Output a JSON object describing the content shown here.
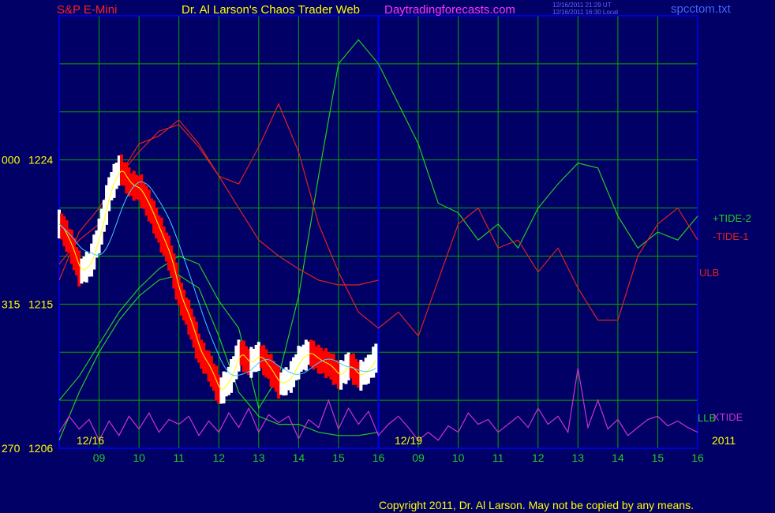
{
  "header": {
    "symbol": "S&P E-Mini",
    "title": "Dr. Al Larson's Chaos Trader Web",
    "site": "Daytradingforecasts.com",
    "time_ut": "12/16/2011 21:29 UT",
    "time_local": "12/16/2011 16:30 Local",
    "filename": "spcctom.txt"
  },
  "copyright": "Copyright 2011, Dr. Al Larson. May not be copied by any means.",
  "colors": {
    "background": "#000066",
    "grid": "#00aa00",
    "frame": "#0000ff",
    "tide_plus": "#22cc22",
    "tide_minus": "#cc1111",
    "xtide": "#cc33cc",
    "price_up": "#ffffff",
    "price_down": "#ff0000",
    "ma_fast": "#ffff00",
    "ma_slow": "#44ccff"
  },
  "chart_data": {
    "type": "line",
    "title": "S&P E-Mini",
    "y_labels": [
      {
        "left": "000",
        "price": "1224",
        "value": 1224
      },
      {
        "left": "315",
        "price": "1215",
        "value": 1215
      },
      {
        "left": "270",
        "price": "1206",
        "value": 1206
      }
    ],
    "ylim": [
      1206,
      1233
    ],
    "date_labels": [
      "12/16",
      "12/19"
    ],
    "year_label": "2011",
    "hour_ticks": [
      "09",
      "10",
      "11",
      "12",
      "13",
      "14",
      "15",
      "16",
      "09",
      "10",
      "11",
      "12",
      "13",
      "14",
      "15",
      "16"
    ],
    "series_labels": [
      {
        "name": "+TIDE-2",
        "color": "#22cc22"
      },
      {
        "name": "-TIDE-1",
        "color": "#dd2222"
      },
      {
        "name": "ULB",
        "color": "#dd2222"
      },
      {
        "name": "LLB",
        "color": "#22cc22"
      },
      {
        "name": "XTIDE",
        "color": "#cc33cc"
      }
    ],
    "series": [
      {
        "name": "+TIDE-2",
        "color": "#22cc22",
        "x": [
          0,
          0.5,
          1,
          1.5,
          2,
          2.5,
          3,
          3.5,
          4,
          4.5,
          5,
          5.5,
          6,
          6.5,
          7,
          7.5,
          8,
          8.5,
          9,
          9.5,
          10,
          10.5,
          11,
          11.5,
          12,
          12.5,
          13,
          13.5,
          14,
          14.5,
          15,
          15.5,
          16
        ],
        "y": [
          1209,
          1210.5,
          1212.5,
          1214.5,
          1216,
          1217.2,
          1218,
          1217.5,
          1215.2,
          1213.5,
          1208.5,
          1210.5,
          1215.5,
          1223,
          1230,
          1231.5,
          1230,
          1227.5,
          1225,
          1221.3,
          1220.7,
          1219,
          1220,
          1218.5,
          1221,
          1222.5,
          1223.8,
          1223.5,
          1220.5,
          1218.5,
          1219.5,
          1219,
          1220.5
        ]
      },
      {
        "name": "-TIDE-1",
        "color": "#dd2222",
        "x": [
          0,
          0.5,
          1,
          1.5,
          2,
          2.5,
          3,
          3.5,
          4,
          4.5,
          5,
          5.5,
          6,
          6.5,
          7,
          7.5,
          8,
          8.5,
          9,
          9.5,
          10,
          10.5,
          11,
          11.5,
          12,
          12.5,
          13,
          13.5,
          14,
          14.5,
          15,
          15.5,
          16
        ],
        "y": [
          1217.5,
          1219,
          1220,
          1223,
          1225,
          1225.5,
          1226.5,
          1225,
          1223,
          1222.5,
          1224.8,
          1227.5,
          1224.5,
          1220,
          1217,
          1214.5,
          1213.5,
          1214.5,
          1213,
          1216.5,
          1220,
          1221,
          1218.5,
          1219,
          1217,
          1218.5,
          1216,
          1214,
          1214,
          1218,
          1220,
          1221,
          1219
        ]
      },
      {
        "name": "ULB",
        "color": "#dd2222",
        "x": [
          0,
          0.5,
          1,
          1.5,
          2,
          2.5,
          3,
          3.5,
          4,
          4.5,
          5,
          5.5,
          6,
          6.5,
          7,
          7.5,
          8
        ],
        "y": [
          1216.5,
          1219.5,
          1221,
          1223,
          1224.5,
          1225.8,
          1226.2,
          1224.8,
          1223,
          1221,
          1219,
          1218,
          1217.2,
          1216.5,
          1216.2,
          1216.2,
          1216.5
        ]
      },
      {
        "name": "LLB",
        "color": "#22cc22",
        "x": [
          0,
          0.5,
          1,
          1.5,
          2,
          2.5,
          3,
          3.5,
          4,
          4.5,
          5,
          5.5,
          6,
          6.5,
          7,
          7.5,
          8
        ],
        "y": [
          1206.5,
          1209.5,
          1212,
          1214,
          1215.5,
          1216.5,
          1216.8,
          1216,
          1213,
          1209.5,
          1208,
          1207.5,
          1207.5,
          1207,
          1206.8,
          1206.8,
          1207
        ]
      },
      {
        "name": "XTIDE",
        "color": "#cc33cc",
        "x": [
          0,
          0.25,
          0.5,
          0.75,
          1,
          1.25,
          1.5,
          1.75,
          2,
          2.25,
          2.5,
          2.75,
          3,
          3.25,
          3.5,
          3.75,
          4,
          4.25,
          4.5,
          4.75,
          5,
          5.25,
          5.5,
          5.75,
          6,
          6.25,
          6.5,
          6.75,
          7,
          7.25,
          7.5,
          7.75,
          8,
          8.25,
          8.5,
          8.75,
          9,
          9.25,
          9.5,
          9.75,
          10,
          10.25,
          10.5,
          10.75,
          11,
          11.25,
          11.5,
          11.75,
          12,
          12.25,
          12.5,
          12.75,
          13,
          13.25,
          13.5,
          13.75,
          14,
          14.25,
          14.5,
          14.75,
          15,
          15.25,
          15.5,
          15.75,
          16
        ],
        "y": [
          1207,
          1208,
          1207.2,
          1207.8,
          1206.5,
          1207.7,
          1206.8,
          1208,
          1207.2,
          1208.2,
          1207,
          1207.8,
          1207.5,
          1208,
          1206.8,
          1207.7,
          1207,
          1208.2,
          1207.3,
          1208.5,
          1207,
          1208.1,
          1207.6,
          1208,
          1206.6,
          1207.8,
          1207.3,
          1209,
          1207.2,
          1208.5,
          1207.5,
          1208.3,
          1206.8,
          1207.5,
          1208,
          1207.3,
          1206.5,
          1207,
          1206.5,
          1207.4,
          1207,
          1208.2,
          1207.5,
          1207.8,
          1207,
          1207.5,
          1208,
          1207.3,
          1208.5,
          1207.5,
          1208,
          1207,
          1211,
          1207.3,
          1209,
          1207.2,
          1207.8,
          1206.8,
          1207.3,
          1207.8,
          1208,
          1207.4,
          1207.7,
          1207.3,
          1207
        ]
      },
      {
        "name": "Price",
        "color": "#ffffff",
        "x": [
          0,
          0.25,
          0.5,
          0.75,
          1,
          1.25,
          1.5,
          1.75,
          2,
          2.25,
          2.5,
          2.75,
          3,
          3.25,
          3.5,
          3.75,
          4,
          4.25,
          4.5,
          4.75,
          5,
          5.25,
          5.5,
          5.75,
          6,
          6.25,
          6.5,
          6.75,
          7,
          7.25,
          7.5,
          7.75,
          8
        ],
        "y": [
          1220,
          1218.8,
          1217,
          1217.5,
          1219.5,
          1222.2,
          1223.5,
          1222.5,
          1222.2,
          1221,
          1219.5,
          1218,
          1215.5,
          1214,
          1212,
          1211,
          1209.5,
          1210.3,
          1212,
          1211.3,
          1211.8,
          1211,
          1210,
          1210.3,
          1211.5,
          1212,
          1211.5,
          1211.2,
          1210.5,
          1211.2,
          1210.5,
          1211,
          1212
        ]
      }
    ]
  }
}
